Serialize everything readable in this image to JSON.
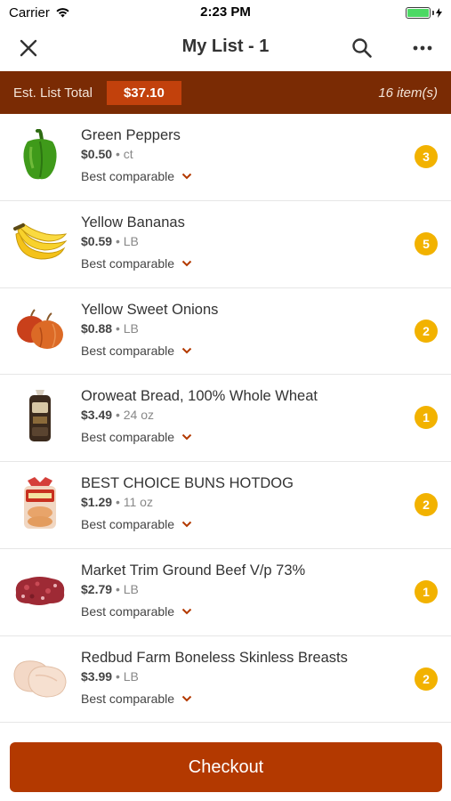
{
  "status_bar": {
    "carrier": "Carrier",
    "time": "2:23 PM"
  },
  "nav": {
    "title": "My List - 1",
    "close_icon": "close-icon",
    "search_icon": "search-icon",
    "more_icon": "more-icon"
  },
  "summary": {
    "label": "Est. List Total",
    "total": "$37.10",
    "count": "16 item(s)"
  },
  "items": [
    {
      "name": "Green Peppers",
      "price": "$0.50",
      "unit": "ct",
      "compare": "Best comparable",
      "qty": "3",
      "icon": "green-pepper"
    },
    {
      "name": "Yellow Bananas",
      "price": "$0.59",
      "unit": "LB",
      "compare": "Best comparable",
      "qty": "5",
      "icon": "bananas"
    },
    {
      "name": "Yellow Sweet Onions",
      "price": "$0.88",
      "unit": "LB",
      "compare": "Best comparable",
      "qty": "2",
      "icon": "onions"
    },
    {
      "name": "Oroweat Bread, 100% Whole Wheat",
      "price": "$3.49",
      "unit": "24 oz",
      "compare": "Best comparable",
      "qty": "1",
      "icon": "bread-loaf"
    },
    {
      "name": "BEST CHOICE BUNS HOTDOG",
      "price": "$1.29",
      "unit": "11 oz",
      "compare": "Best comparable",
      "qty": "2",
      "icon": "hotdog-buns"
    },
    {
      "name": "Market Trim Ground Beef V/p 73%",
      "price": "$2.79",
      "unit": "LB",
      "compare": "Best comparable",
      "qty": "1",
      "icon": "ground-beef"
    },
    {
      "name": "Redbud Farm Boneless Skinless Breasts",
      "price": "$3.99",
      "unit": "LB",
      "compare": "Best comparable",
      "qty": "2",
      "icon": "chicken-breasts"
    }
  ],
  "checkout": {
    "label": "Checkout"
  },
  "colors": {
    "accent": "#7a2b04",
    "button": "#b33900",
    "badge": "#f2b200",
    "chevron": "#b33900"
  }
}
